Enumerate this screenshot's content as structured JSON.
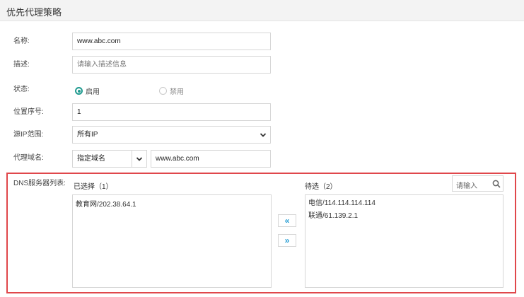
{
  "header": {
    "title": "优先代理策略"
  },
  "form": {
    "name": {
      "label": "名称:",
      "value": "www.abc.com"
    },
    "description": {
      "label": "描述:",
      "placeholder": "请输入描述信息"
    },
    "status": {
      "label": "状态:",
      "options": [
        "启用",
        "禁用"
      ],
      "selected": "启用"
    },
    "position": {
      "label": "位置序号:",
      "value": "1"
    },
    "source_ip": {
      "label": "源IP范围:",
      "value": "所有IP"
    },
    "proxy_domain": {
      "label": "代理域名:",
      "mode": "指定域名",
      "value": "www.abc.com"
    }
  },
  "dns": {
    "label": "DNS服务器列表:",
    "selected_title": "已选择（1）",
    "selected_items": [
      "教育网/202.38.64.1"
    ],
    "candidate_title": "待选（2）",
    "candidate_items": [
      "电信/114.114.114.114",
      "联通/61.139.2.1"
    ],
    "search_placeholder": "请输入",
    "move_left_label": "«",
    "move_right_label": "»"
  },
  "colors": {
    "accent": "#1f9a8f",
    "highlight_border": "#e0474b",
    "transfer_button": "#1f9ad2"
  }
}
